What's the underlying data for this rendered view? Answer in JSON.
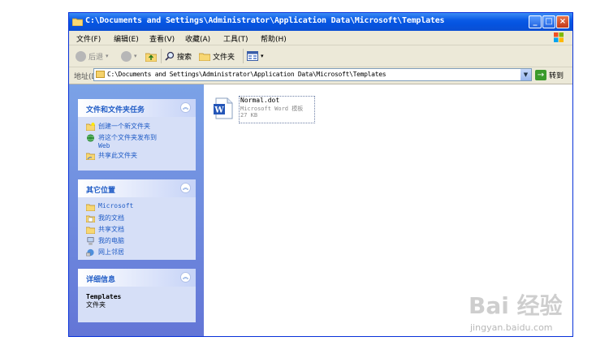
{
  "window": {
    "title": "C:\\Documents and Settings\\Administrator\\Application Data\\Microsoft\\Templates",
    "buttons": [
      "_",
      "□",
      "×"
    ]
  },
  "menu": {
    "items": [
      "文件(F)",
      "编辑(E)",
      "查看(V)",
      "收藏(A)",
      "工具(T)",
      "帮助(H)"
    ]
  },
  "toolbar": {
    "back": "后退",
    "search": "搜索",
    "folders": "文件夹"
  },
  "address": {
    "label": "地址(D)",
    "value": "C:\\Documents and Settings\\Administrator\\Application Data\\Microsoft\\Templates",
    "go": "转到"
  },
  "tasks_panel": {
    "title": "文件和文件夹任务",
    "items": [
      {
        "label": "创建一个新文件夹",
        "icon": "new-folder-icon"
      },
      {
        "label": "将这个文件夹发布到",
        "label2": "Web",
        "icon": "publish-web-icon"
      },
      {
        "label": "共享此文件夹",
        "icon": "share-folder-icon"
      }
    ]
  },
  "other_panel": {
    "title": "其它位置",
    "items": [
      {
        "label": "Microsoft",
        "icon": "folder-icon"
      },
      {
        "label": "我的文档",
        "icon": "my-documents-icon"
      },
      {
        "label": "共享文档",
        "icon": "shared-documents-icon"
      },
      {
        "label": "我的电脑",
        "icon": "my-computer-icon"
      },
      {
        "label": "网上邻居",
        "icon": "network-places-icon"
      }
    ]
  },
  "details_panel": {
    "title": "详细信息",
    "name": "Templates",
    "type": "文件夹"
  },
  "files": [
    {
      "name": "Normal.dot",
      "type": "Microsoft Word 模板",
      "size": "27 KB"
    }
  ],
  "watermark": {
    "text": "Bai 经验",
    "url": "jingyan.baidu.com"
  },
  "colors": {
    "titlebar": "#0a5ae6",
    "sidebar": "#7ba2e7",
    "panel": "#d6dff7",
    "link": "#215dc6"
  }
}
